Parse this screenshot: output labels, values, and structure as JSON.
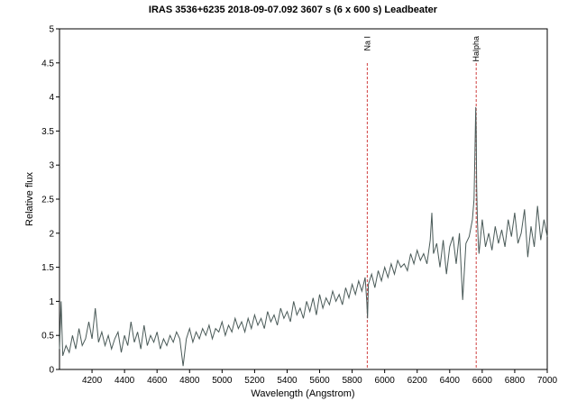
{
  "chart_data": {
    "type": "line",
    "title": "IRAS 3536+6235   2018-09-07.092   3607 s (6 x 600 s)   Leadbeater",
    "xlabel": "Wavelength (Angstrom)",
    "ylabel": "Relative flux",
    "xlim": [
      4000,
      7000
    ],
    "ylim": [
      0,
      5
    ],
    "x_ticks": [
      "4200",
      "4400",
      "4600",
      "4800",
      "5000",
      "5200",
      "5400",
      "5600",
      "5800",
      "6000",
      "6200",
      "6400",
      "6600",
      "6800",
      "7000"
    ],
    "y_ticks": [
      "0",
      "0.5",
      "1",
      "1.5",
      "2",
      "2.5",
      "3",
      "3.5",
      "4",
      "4.5",
      "5"
    ],
    "grid": false,
    "series_color": "#4a5a58",
    "annotation_color": "#d04040",
    "annotations": [
      {
        "label": "Na I",
        "x": 5893
      },
      {
        "label": "Halpha",
        "x": 6563
      }
    ],
    "series": [
      {
        "x": [
          4000,
          4010,
          4020,
          4040,
          4060,
          4080,
          4100,
          4120,
          4140,
          4160,
          4180,
          4200,
          4220,
          4240,
          4260,
          4280,
          4300,
          4320,
          4340,
          4360,
          4380,
          4400,
          4420,
          4440,
          4460,
          4480,
          4500,
          4520,
          4540,
          4560,
          4580,
          4600,
          4620,
          4640,
          4660,
          4680,
          4700,
          4720,
          4740,
          4760,
          4780,
          4800,
          4820,
          4840,
          4860,
          4880,
          4900,
          4920,
          4940,
          4960,
          4980,
          5000,
          5020,
          5040,
          5060,
          5080,
          5100,
          5120,
          5140,
          5160,
          5180,
          5200,
          5220,
          5240,
          5260,
          5280,
          5300,
          5320,
          5340,
          5360,
          5380,
          5400,
          5420,
          5440,
          5460,
          5480,
          5500,
          5520,
          5540,
          5560,
          5580,
          5600,
          5620,
          5640,
          5660,
          5680,
          5700,
          5720,
          5740,
          5760,
          5780,
          5800,
          5820,
          5840,
          5860,
          5880,
          5890,
          5895,
          5900,
          5920,
          5940,
          5960,
          5980,
          6000,
          6020,
          6040,
          6060,
          6080,
          6100,
          6120,
          6140,
          6160,
          6180,
          6200,
          6220,
          6240,
          6260,
          6280,
          6290,
          6300,
          6320,
          6340,
          6360,
          6380,
          6400,
          6420,
          6440,
          6460,
          6480,
          6500,
          6520,
          6540,
          6550,
          6555,
          6560,
          6563,
          6566,
          6570,
          6575,
          6580,
          6600,
          6620,
          6640,
          6660,
          6680,
          6700,
          6720,
          6740,
          6760,
          6780,
          6800,
          6820,
          6840,
          6860,
          6880,
          6900,
          6920,
          6940,
          6960,
          6980,
          7000
        ],
        "values": [
          0.3,
          1.0,
          0.2,
          0.35,
          0.25,
          0.5,
          0.3,
          0.6,
          0.35,
          0.45,
          0.7,
          0.45,
          0.9,
          0.4,
          0.55,
          0.35,
          0.5,
          0.3,
          0.45,
          0.55,
          0.25,
          0.5,
          0.35,
          0.7,
          0.4,
          0.55,
          0.3,
          0.65,
          0.35,
          0.5,
          0.4,
          0.55,
          0.3,
          0.45,
          0.35,
          0.5,
          0.4,
          0.55,
          0.45,
          0.05,
          0.45,
          0.6,
          0.4,
          0.55,
          0.45,
          0.6,
          0.5,
          0.65,
          0.45,
          0.6,
          0.55,
          0.7,
          0.5,
          0.65,
          0.55,
          0.75,
          0.6,
          0.7,
          0.55,
          0.75,
          0.6,
          0.8,
          0.65,
          0.75,
          0.6,
          0.85,
          0.7,
          0.8,
          0.65,
          0.9,
          0.75,
          0.85,
          0.7,
          1.0,
          0.8,
          0.9,
          0.75,
          1.0,
          0.85,
          1.05,
          0.8,
          1.1,
          0.9,
          1.05,
          0.95,
          1.15,
          1.0,
          1.1,
          0.95,
          1.2,
          1.05,
          1.25,
          1.1,
          1.3,
          1.15,
          1.35,
          1.0,
          0.75,
          1.25,
          1.4,
          1.2,
          1.45,
          1.3,
          1.5,
          1.35,
          1.55,
          1.4,
          1.6,
          1.5,
          1.55,
          1.45,
          1.7,
          1.55,
          1.75,
          1.6,
          1.7,
          1.55,
          1.9,
          2.3,
          1.7,
          1.85,
          1.5,
          1.9,
          1.4,
          1.8,
          1.95,
          1.55,
          2.0,
          1.02,
          1.85,
          1.95,
          2.2,
          2.5,
          3.2,
          3.85,
          3.5,
          2.7,
          2.2,
          1.9,
          1.7,
          2.2,
          1.8,
          2.0,
          1.75,
          2.1,
          1.85,
          2.05,
          1.8,
          2.2,
          1.95,
          2.3,
          1.85,
          2.0,
          2.35,
          1.65,
          2.1,
          1.8,
          2.4,
          1.9,
          2.2,
          1.95
        ]
      }
    ]
  }
}
